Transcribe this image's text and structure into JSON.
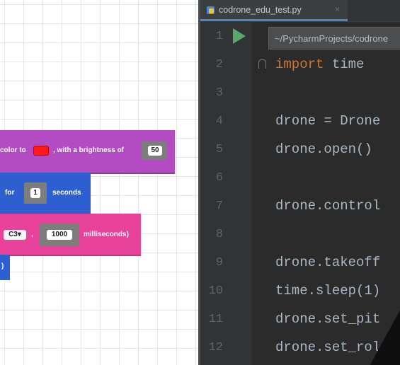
{
  "workspace": {
    "blocks": [
      {
        "id": "set-color",
        "text_before": "color to",
        "text_mid": ", with a brightness of",
        "brightness": "50",
        "swatch_color": "#ff1a1a"
      },
      {
        "id": "hover",
        "text_before": "for",
        "value": "1",
        "text_after": "seconds"
      },
      {
        "id": "play-note",
        "note": "C3",
        "dropdown_arrow": "▾",
        "sep": ",",
        "value": "1000",
        "text_after": "milliseconds)"
      },
      {
        "id": "stub",
        "text": ")"
      }
    ]
  },
  "editor": {
    "tab": {
      "label": "codrone_edu_test.py",
      "close": "×",
      "icon": "python-file-icon"
    },
    "tooltip": "~/PycharmProjects/codrone",
    "line_numbers": [
      "1",
      "2",
      "3",
      "4",
      "5",
      "6",
      "7",
      "8",
      "9",
      "10",
      "11",
      "12"
    ],
    "lines": {
      "l2_kw": "import",
      "l2_rest": " time",
      "l4": "drone = Drone",
      "l5": "drone.open()",
      "l7": "drone.control",
      "l9": "drone.takeoff",
      "l10": "time.sleep(1)",
      "l11": "drone.set_pit",
      "l12": "drone.set_rol"
    },
    "colors": {
      "keyword": "#cc7832",
      "text": "#a9b7c6",
      "background": "#2b2b2b"
    }
  }
}
